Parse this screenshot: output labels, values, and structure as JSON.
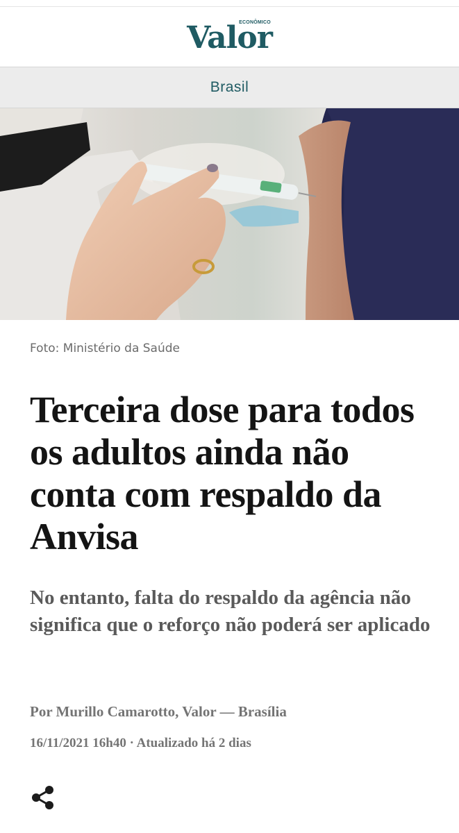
{
  "header": {
    "logo_text": "Valor",
    "logo_superscript": "ECONÔMICO",
    "brand_color": "#1f5b63"
  },
  "section": {
    "label": "Brasil"
  },
  "hero_image": {
    "caption": "Foto: Ministério da Saúde"
  },
  "article": {
    "headline": "Terceira dose para todos os adultos ainda não conta com respaldo da Anvisa",
    "subtitle": "No entanto, falta do respaldo da agência não significa que o reforço não poderá ser aplicado",
    "byline": "Por Murillo Camarotto, Valor — Brasília",
    "dateline": "16/11/2021 16h40 · Atualizado há 2 dias"
  },
  "actions": {
    "share_icon": "share-icon"
  }
}
